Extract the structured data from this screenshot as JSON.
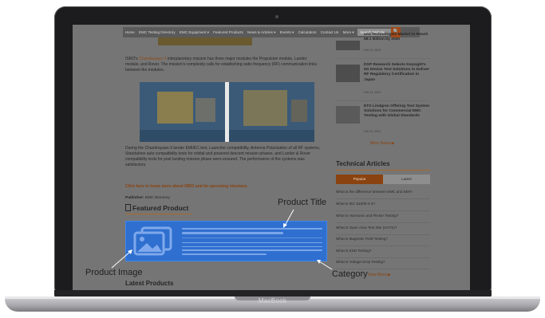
{
  "device": {
    "brand": "MacBook"
  },
  "site": {
    "nav": [
      "Home",
      "EMC Testing Directory",
      "EMC Equipment ▾",
      "Featured Products",
      "News & Articles ▾",
      "Events ▾",
      "Calculators",
      "Contact Us",
      "More ▾"
    ],
    "search_placeholder": "Search Website",
    "search_button": "🔍"
  },
  "article": {
    "para1_pre": "ISRO's ",
    "para1_link": "Chandrayaan-3",
    "para1_post": " interplanetary mission has three major modules the Propulsion module, Lander module, and Rover. The mission's complexity calls for establishing radio frequency (RF) communication links between the modules.",
    "para2": "During the Chandrayaan-3 lander EMI/EC test, Launcher compatibility, Antenna Polarization of all RF systems, Standalone auto compatibility tests for orbital and powered descent mission phases, and Lander & Rover compatibility tests for post landing mission phase were ensured. The performance of the systems was satisfactory.",
    "cta": "Click here to know more about ISRO and its upcoming missions.",
    "publisher_label": "Publisher:",
    "publisher": "EMC Directory",
    "featured_heading": "Featured Product",
    "latest_heading": "Latest Products"
  },
  "sidebar": {
    "news": [
      {
        "title": "and Technologies Market to Reach $8.1 Billion by 2030",
        "date": "Feb 21, 2023"
      },
      {
        "title": "DSP Research Selects Keysight's 5G Device Test Solutions to Deliver RF Regulatory Certification in Japan",
        "date": "Feb 21, 2023"
      },
      {
        "title": "ETS Lindgren Offering Test System Solutions for Commercial EMC Testing with Global Standards",
        "date": "Feb 21, 2023"
      }
    ],
    "more_news": "More News ▶",
    "tech_heading": "Technical Articles",
    "tabs": [
      "Popular",
      "Latest"
    ],
    "articles": [
      "What is the difference between EMC and EMI?",
      "What is IEC 61000-4-3?",
      "What is Harmonic and Flicker Testing?",
      "What is Open Area Test Site (OATS)?",
      "What is Magnetic Field Testing?",
      "What is ESD Testing?",
      "What is Voltage Drop Testing?"
    ],
    "view_more": "View More ▶"
  },
  "callouts": {
    "product_title": "Product Title",
    "product_image": "Product Image",
    "category": "Category"
  },
  "colors": {
    "highlight": "#2f6fcf",
    "accent": "#8a4310"
  }
}
